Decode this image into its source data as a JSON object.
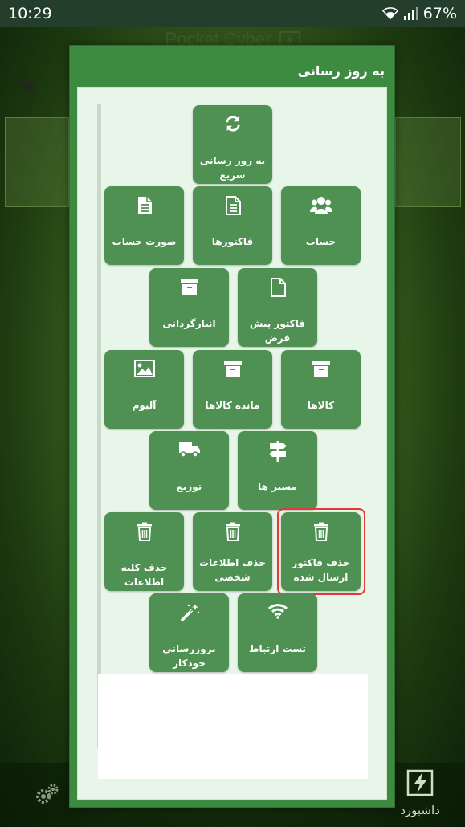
{
  "status_bar": {
    "time": "10:29",
    "battery": "67%"
  },
  "background_app": {
    "title": "Pocket Cyber",
    "dashboard_label": "داشبورد"
  },
  "dialog": {
    "title": "به روز رسانی",
    "tiles": [
      {
        "label": "به روز رسانی سریع",
        "icon": "refresh-icon"
      },
      {
        "label": "حساب",
        "icon": "users-icon"
      },
      {
        "label": "فاکتورها",
        "icon": "document-icon"
      },
      {
        "label": "صورت حساب",
        "icon": "document-icon"
      },
      {
        "label": "فاکتور پیش فرض",
        "icon": "blank-document-icon"
      },
      {
        "label": "انبارگردانی",
        "icon": "archive-icon"
      },
      {
        "label": "کالاها",
        "icon": "archive-icon"
      },
      {
        "label": "مانده کالاها",
        "icon": "archive-icon"
      },
      {
        "label": "آلبوم",
        "icon": "image-icon"
      },
      {
        "label": "مسیر ها",
        "icon": "signpost-icon"
      },
      {
        "label": "توزیع",
        "icon": "truck-icon"
      },
      {
        "label": "حذف فاکتور ارسال شده",
        "icon": "trash-icon"
      },
      {
        "label": "حذف اطلاعات شخصی",
        "icon": "trash-icon"
      },
      {
        "label": "حذف کلیه اطلاعات",
        "icon": "trash-icon"
      },
      {
        "label": "تست ارتباط",
        "icon": "wifi-icon"
      },
      {
        "label": "بروزرسانی خودکار",
        "icon": "magic-wand-icon"
      }
    ]
  },
  "colors": {
    "dialog_bg": "#3d8b40",
    "tile_bg": "#4f9152",
    "body_bg": "#e8f5e9",
    "highlight": "#e53935"
  }
}
